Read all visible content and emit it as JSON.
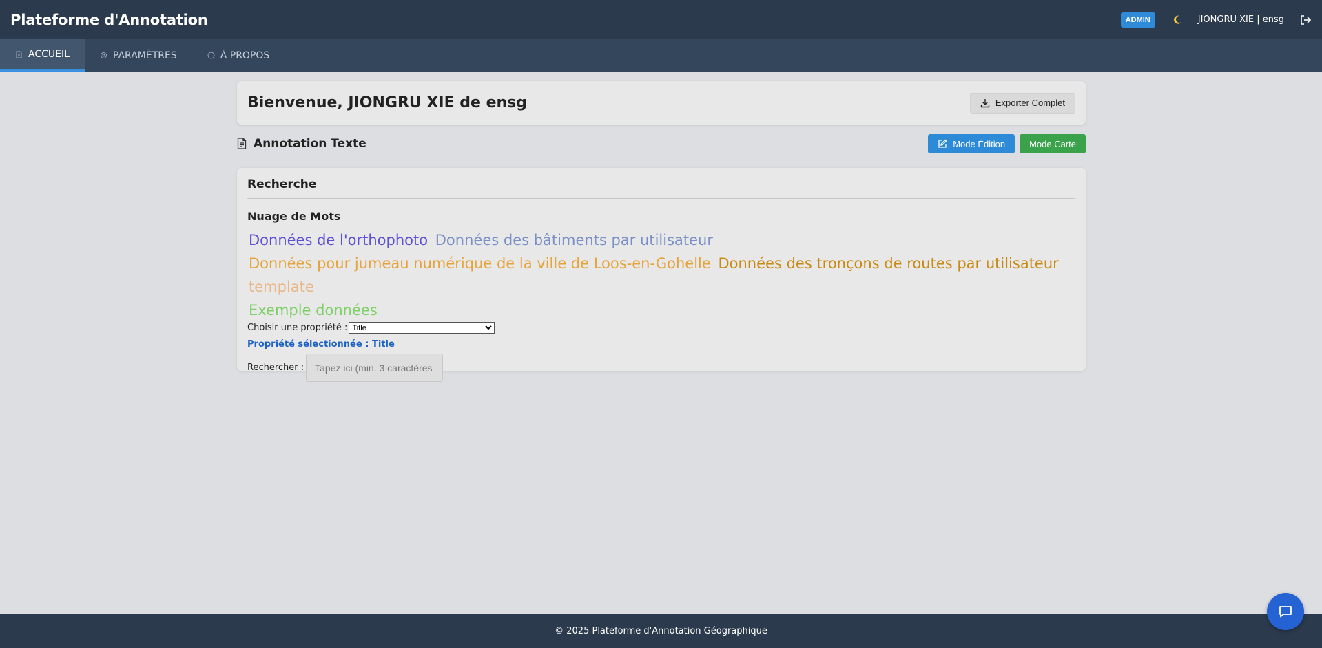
{
  "header": {
    "app_title": "Plateforme d'Annotation",
    "admin_badge": "ADMIN",
    "user_label": "JIONGRU XIE | ensg",
    "theme_icon": "moon-icon",
    "logout_icon": "logout-icon"
  },
  "nav": {
    "tabs": [
      {
        "label": "ACCUEIL",
        "icon": "document-icon",
        "active": true
      },
      {
        "label": "PARAMÈTRES",
        "icon": "gear-icon",
        "active": false
      },
      {
        "label": "À PROPOS",
        "icon": "info-icon",
        "active": false
      }
    ]
  },
  "welcome": {
    "title": "Bienvenue, JIONGRU XIE de ensg",
    "export_label": "Exporter Complet"
  },
  "section": {
    "title": "Annotation Texte",
    "edit_mode_label": "Mode Édition",
    "map_mode_label": "Mode Carte"
  },
  "search": {
    "title": "Recherche",
    "cloud_title": "Nuage de Mots",
    "words": [
      {
        "text": "Données de l'orthophoto",
        "color": "#5b4fd6"
      },
      {
        "text": "Données des bâtiments par utilisateur",
        "color": "#7a8fc8"
      },
      {
        "text": "Données pour jumeau numérique de la ville de Loos-en-Gohelle",
        "color": "#e6a33a"
      },
      {
        "text": "Données des tronçons de routes par utilisateur",
        "color": "#c98a12"
      },
      {
        "text": "template",
        "color": "#e8b88a"
      },
      {
        "text": "Exemple données",
        "color": "#7fd06a"
      }
    ],
    "property_label": "Choisir une propriété :",
    "property_value": "Title",
    "selected_label": "Propriété sélectionnée : Title",
    "search_label": "Rechercher :",
    "search_placeholder": "Tapez ici (min. 3 caractères"
  },
  "footer": {
    "text": "© 2025 Plateforme d'Annotation Géographique"
  },
  "colors": {
    "header_bg": "#2b3a4d",
    "nav_bg": "#34465c",
    "accent_blue": "#2d8ad6",
    "accent_green": "#3aa24a",
    "chat_button": "#2563d4"
  }
}
